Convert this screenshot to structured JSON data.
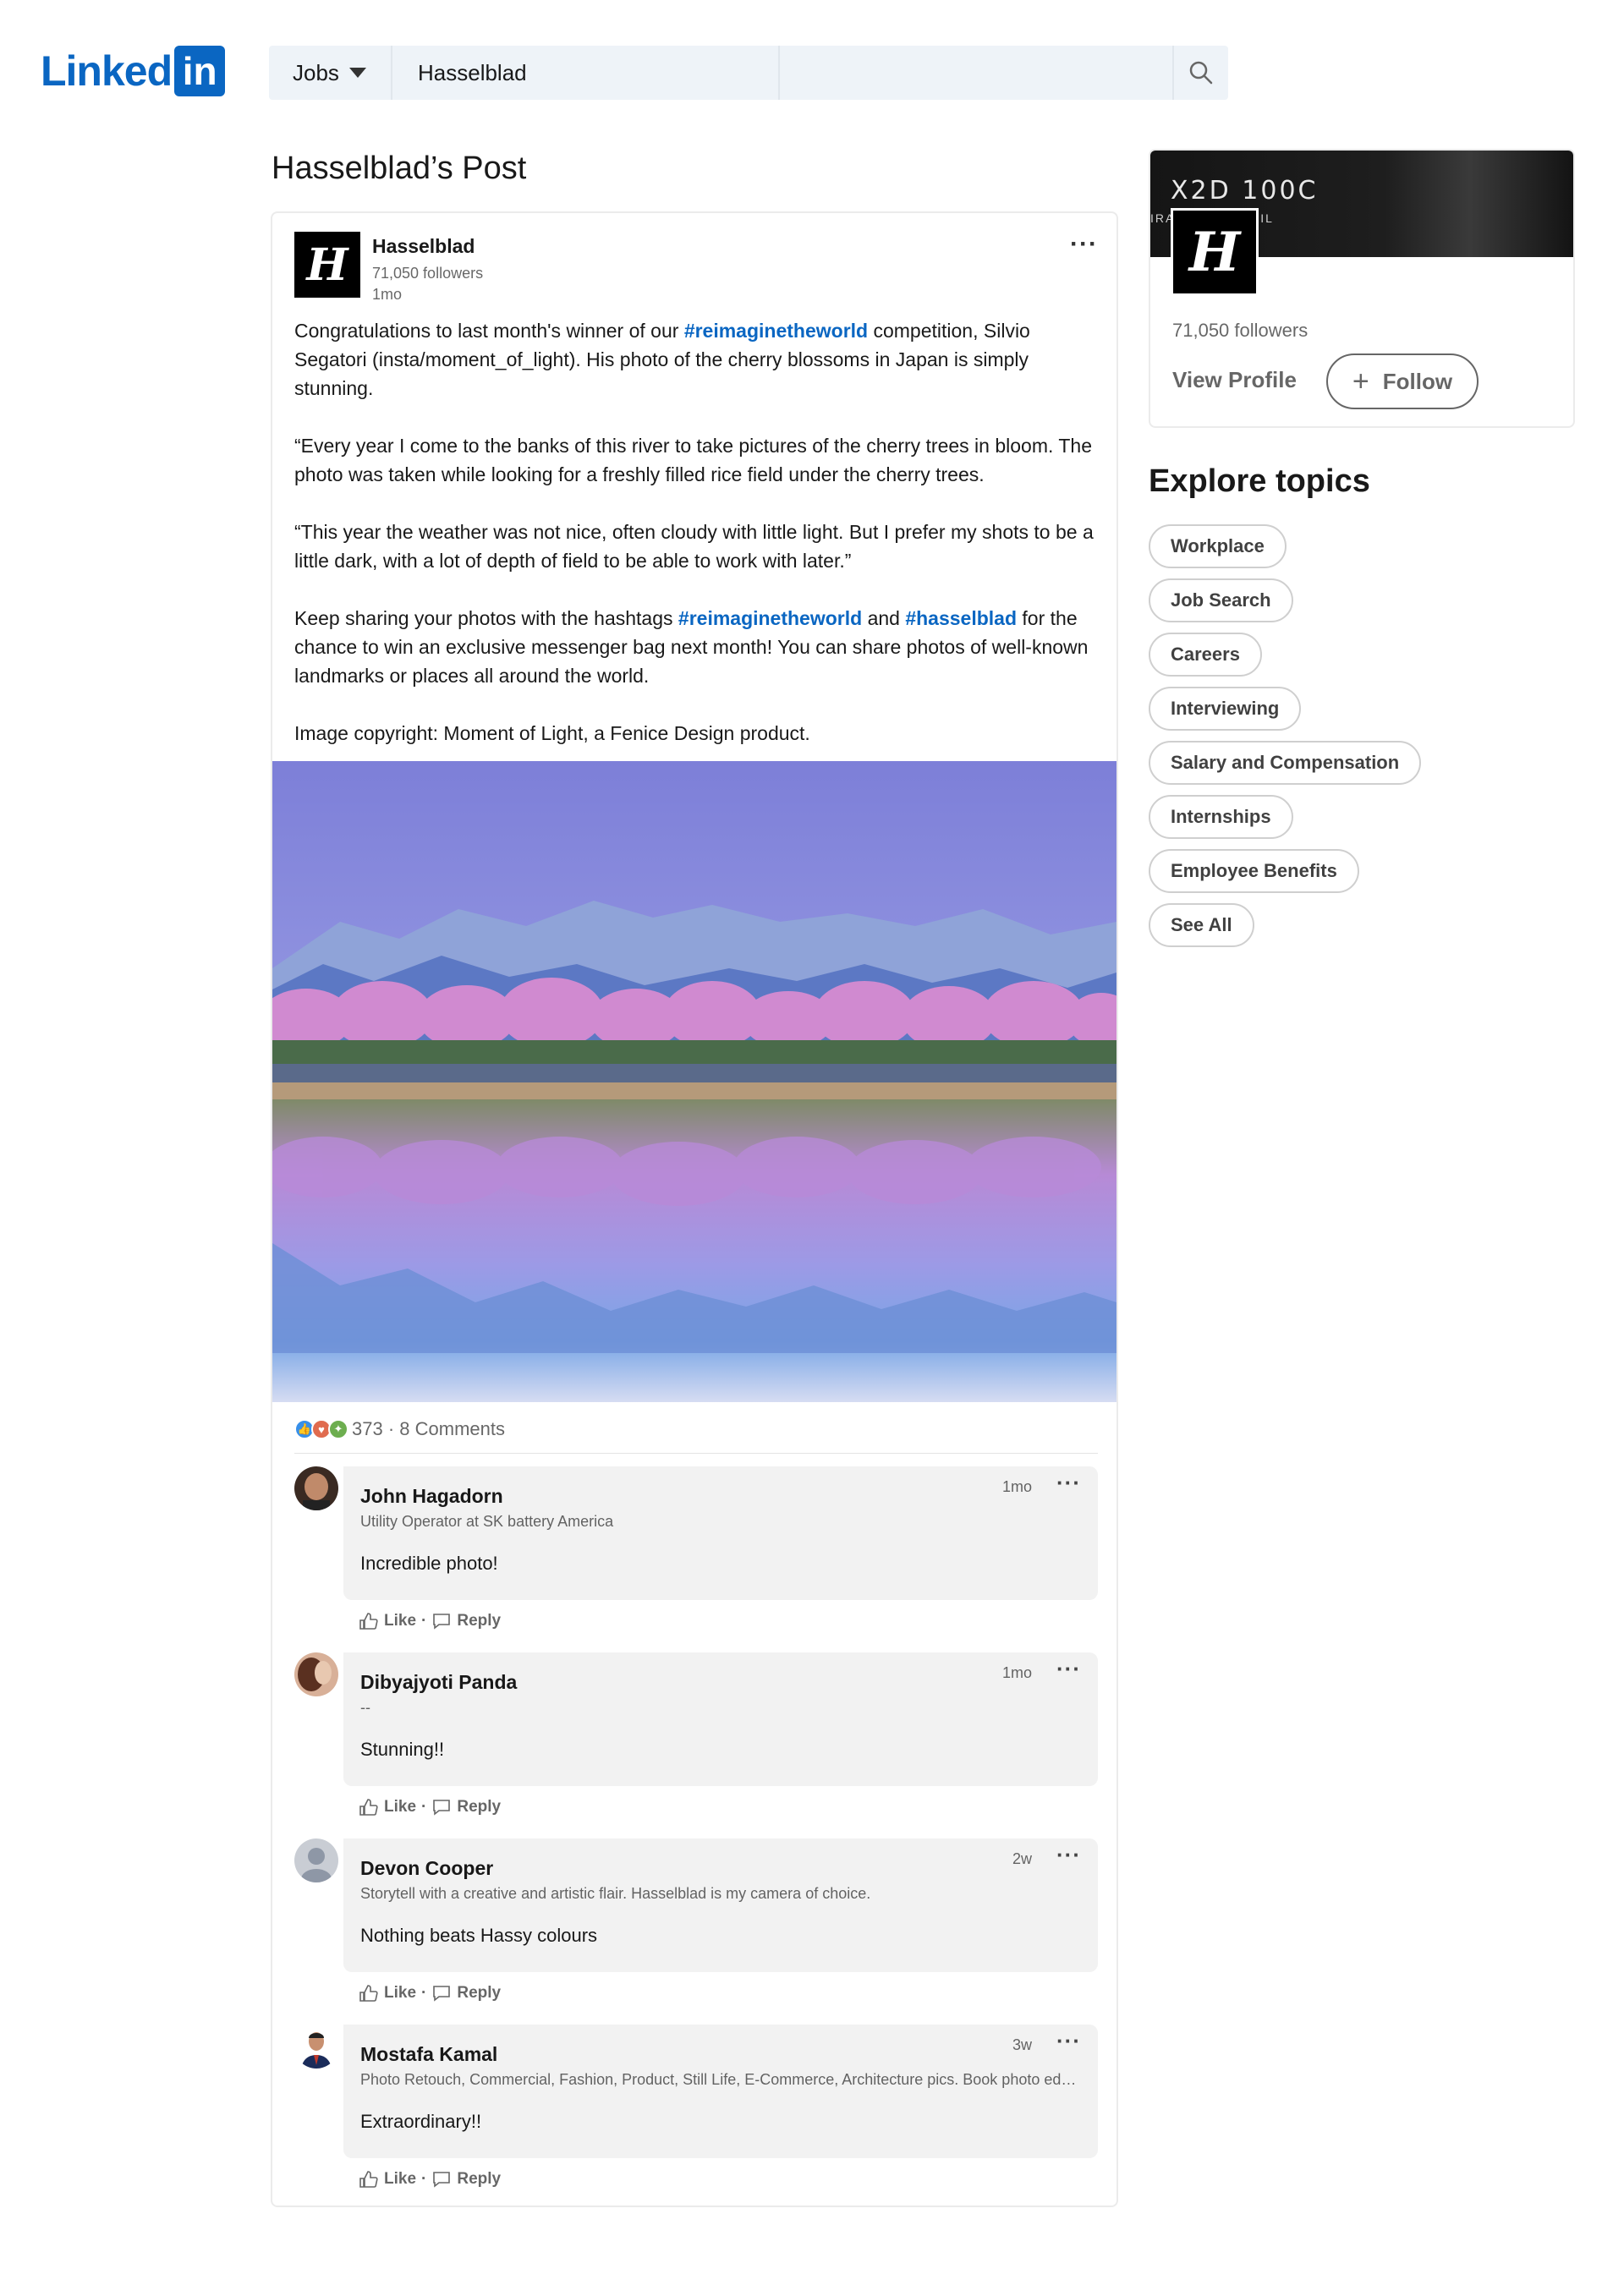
{
  "header": {
    "logo_text": "Linked",
    "logo_in": "in",
    "search_category": "Jobs",
    "search_value": "Hasselblad"
  },
  "page_title": "Hasselblad’s Post",
  "post": {
    "author": "Hasselblad",
    "logo_glyph": "H",
    "followers": "71,050 followers",
    "time": "1mo",
    "menu": "···",
    "p1_a": "Congratulations to last month's winner of our ",
    "p1_tag": "#reimaginetheworld",
    "p1_b": " competition, Silvio Segatori (insta/moment_of_light). His photo of the cherry blossoms in Japan is simply stunning.",
    "p2": "“Every year I come to the banks of this river to take pictures of the cherry trees in bloom. The photo was taken while looking for a freshly filled rice field under the cherry trees.",
    "p3": "“This year the weather was not nice, often cloudy with little light. But I prefer my shots to be a little dark, with a lot of depth of field to be able to work with later.”",
    "p4_a": "Keep sharing your photos with the hashtags ",
    "p4_tag1": "#reimaginetheworld",
    "p4_b": " and ",
    "p4_tag2": "#hasselblad",
    "p4_c": " for the chance to win an exclusive messenger bag next month! You can share photos of well-known landmarks or places all around the world.",
    "p5": "Image copyright: Moment of Light, a Fenice Design product.",
    "reaction_count": "373",
    "comments_count": "· 8 Comments"
  },
  "comments": [
    {
      "name": "John Hagadorn",
      "headline": "Utility Operator at SK battery America",
      "text": "Incredible photo!",
      "time": "1mo",
      "like": "Like",
      "reply": "Reply"
    },
    {
      "name": "Dibyajyoti Panda",
      "headline": "--",
      "text": "Stunning!!",
      "time": "1mo",
      "like": "Like",
      "reply": "Reply"
    },
    {
      "name": "Devon Cooper",
      "headline": "Storytell with a creative and artistic flair. Hasselblad is my camera of choice.",
      "text": "Nothing beats Hassy colours",
      "time": "2w",
      "like": "Like",
      "reply": "Reply"
    },
    {
      "name": "Mostafa Kamal",
      "headline": "Photo Retouch, Commercial, Fashion, Product, Still Life, E-Commerce, Architecture pics. Book photo editing services",
      "text": "Extraordinary!!",
      "time": "3w",
      "like": "Like",
      "reply": "Reply"
    }
  ],
  "company_card": {
    "banner_title": "X2D 100C",
    "banner_sub": "IRA        VERY DETAIL",
    "logo_glyph": "H",
    "followers": "71,050 followers",
    "view_profile": "View Profile",
    "follow_plus": "+",
    "follow": "Follow"
  },
  "explore": {
    "title": "Explore topics",
    "topics": [
      "Workplace",
      "Job Search",
      "Careers",
      "Interviewing",
      "Salary and Compensation",
      "Internships",
      "Employee Benefits",
      "See All"
    ]
  },
  "colors": {
    "brand": "#0a66c2",
    "comment_bg": "#f2f2f2"
  }
}
